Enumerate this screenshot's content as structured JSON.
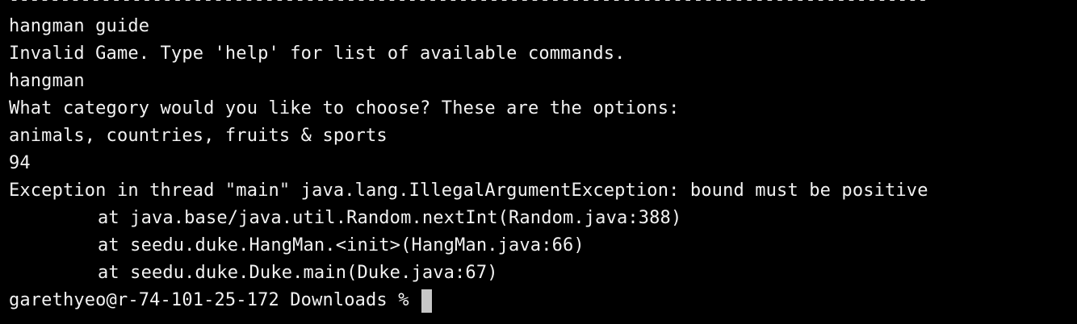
{
  "terminal": {
    "separator": "------------------------------------------------------------------------------------------",
    "lines": [
      "hangman guide",
      "Invalid Game. Type 'help' for list of available commands.",
      "hangman",
      "What category would you like to choose? These are the options:",
      "animals, countries, fruits & sports",
      "94",
      "Exception in thread \"main\" java.lang.IllegalArgumentException: bound must be positive"
    ],
    "stack_trace": [
      "at java.base/java.util.Random.nextInt(Random.java:388)",
      "at seedu.duke.HangMan.<init>(HangMan.java:66)",
      "at seedu.duke.Duke.main(Duke.java:67)"
    ],
    "prompt": "garethyeo@r-74-101-25-172 Downloads % "
  },
  "colors": {
    "background": "#000000",
    "text": "#f2f2f2",
    "cursor": "#c7c7c7"
  }
}
